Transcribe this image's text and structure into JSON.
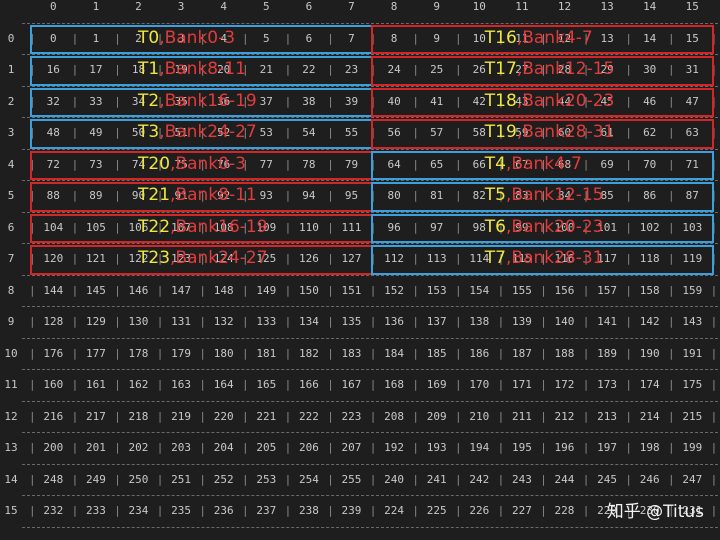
{
  "grid": {
    "columns": [
      "0",
      "1",
      "2",
      "3",
      "4",
      "5",
      "6",
      "7",
      "8",
      "9",
      "10",
      "11",
      "12",
      "13",
      "14",
      "15"
    ],
    "rows": [
      {
        "label": "0",
        "cells": [
          "0",
          "1",
          "2",
          "3",
          "4",
          "5",
          "6",
          "7",
          "8",
          "9",
          "10",
          "11",
          "12",
          "13",
          "14",
          "15"
        ]
      },
      {
        "label": "1",
        "cells": [
          "16",
          "17",
          "18",
          "19",
          "20",
          "21",
          "22",
          "23",
          "24",
          "25",
          "26",
          "27",
          "28",
          "29",
          "30",
          "31"
        ]
      },
      {
        "label": "2",
        "cells": [
          "32",
          "33",
          "34",
          "35",
          "36",
          "37",
          "38",
          "39",
          "40",
          "41",
          "42",
          "43",
          "44",
          "45",
          "46",
          "47"
        ]
      },
      {
        "label": "3",
        "cells": [
          "48",
          "49",
          "50",
          "51",
          "52",
          "53",
          "54",
          "55",
          "56",
          "57",
          "58",
          "59",
          "60",
          "61",
          "62",
          "63"
        ]
      },
      {
        "label": "4",
        "cells": [
          "72",
          "73",
          "74",
          "75",
          "76",
          "77",
          "78",
          "79",
          "64",
          "65",
          "66",
          "67",
          "68",
          "69",
          "70",
          "71"
        ]
      },
      {
        "label": "5",
        "cells": [
          "88",
          "89",
          "90",
          "91",
          "92",
          "93",
          "94",
          "95",
          "80",
          "81",
          "82",
          "83",
          "84",
          "85",
          "86",
          "87"
        ]
      },
      {
        "label": "6",
        "cells": [
          "104",
          "105",
          "106",
          "107",
          "108",
          "109",
          "110",
          "111",
          "96",
          "97",
          "98",
          "99",
          "100",
          "101",
          "102",
          "103"
        ]
      },
      {
        "label": "7",
        "cells": [
          "120",
          "121",
          "122",
          "123",
          "124",
          "125",
          "126",
          "127",
          "112",
          "113",
          "114",
          "115",
          "116",
          "117",
          "118",
          "119"
        ]
      },
      {
        "label": "8",
        "cells": [
          "144",
          "145",
          "146",
          "147",
          "148",
          "149",
          "150",
          "151",
          "152",
          "153",
          "154",
          "155",
          "156",
          "157",
          "158",
          "159"
        ]
      },
      {
        "label": "9",
        "cells": [
          "128",
          "129",
          "130",
          "131",
          "132",
          "133",
          "134",
          "135",
          "136",
          "137",
          "138",
          "139",
          "140",
          "141",
          "142",
          "143"
        ]
      },
      {
        "label": "10",
        "cells": [
          "176",
          "177",
          "178",
          "179",
          "180",
          "181",
          "182",
          "183",
          "184",
          "185",
          "186",
          "187",
          "188",
          "189",
          "190",
          "191"
        ]
      },
      {
        "label": "11",
        "cells": [
          "160",
          "161",
          "162",
          "163",
          "164",
          "165",
          "166",
          "167",
          "168",
          "169",
          "170",
          "171",
          "172",
          "173",
          "174",
          "175"
        ]
      },
      {
        "label": "12",
        "cells": [
          "216",
          "217",
          "218",
          "219",
          "220",
          "221",
          "222",
          "223",
          "208",
          "209",
          "210",
          "211",
          "212",
          "213",
          "214",
          "215"
        ]
      },
      {
        "label": "13",
        "cells": [
          "200",
          "201",
          "202",
          "203",
          "204",
          "205",
          "206",
          "207",
          "192",
          "193",
          "194",
          "195",
          "196",
          "197",
          "198",
          "199"
        ]
      },
      {
        "label": "14",
        "cells": [
          "248",
          "249",
          "250",
          "251",
          "252",
          "253",
          "254",
          "255",
          "240",
          "241",
          "242",
          "243",
          "244",
          "245",
          "246",
          "247"
        ]
      },
      {
        "label": "15",
        "cells": [
          "232",
          "233",
          "234",
          "235",
          "236",
          "237",
          "238",
          "239",
          "224",
          "225",
          "226",
          "227",
          "228",
          "229",
          "230",
          "231"
        ]
      }
    ]
  },
  "groups": [
    {
      "row": 0,
      "half": "left",
      "color": "#3aa0e0",
      "thread": "T0",
      "bank": ",Bank0-3"
    },
    {
      "row": 1,
      "half": "left",
      "color": "#3aa0e0",
      "thread": "T1",
      "bank": ",Bank8-11"
    },
    {
      "row": 2,
      "half": "left",
      "color": "#3aa0e0",
      "thread": "T2",
      "bank": ",Bank16-19"
    },
    {
      "row": 3,
      "half": "left",
      "color": "#3aa0e0",
      "thread": "T3",
      "bank": ",Bank24-27"
    },
    {
      "row": 0,
      "half": "right",
      "color": "#d42626",
      "thread": "T16",
      "bank": ",Bank4-7"
    },
    {
      "row": 1,
      "half": "right",
      "color": "#d42626",
      "thread": "T17",
      "bank": ",Bank12-15"
    },
    {
      "row": 2,
      "half": "right",
      "color": "#d42626",
      "thread": "T18",
      "bank": ",Bank20-23"
    },
    {
      "row": 3,
      "half": "right",
      "color": "#d42626",
      "thread": "T19",
      "bank": ",Bank28-31"
    },
    {
      "row": 4,
      "half": "left",
      "color": "#d42626",
      "thread": "T20",
      "bank": ",Bank0-3"
    },
    {
      "row": 5,
      "half": "left",
      "color": "#d42626",
      "thread": "T21",
      "bank": ",Bank8-11"
    },
    {
      "row": 6,
      "half": "left",
      "color": "#d42626",
      "thread": "T22",
      "bank": ",Bank16-19"
    },
    {
      "row": 7,
      "half": "left",
      "color": "#d42626",
      "thread": "T23",
      "bank": ",Bank24-27"
    },
    {
      "row": 4,
      "half": "right",
      "color": "#3aa0e0",
      "thread": "T4",
      "bank": ",Bank4-7"
    },
    {
      "row": 5,
      "half": "right",
      "color": "#3aa0e0",
      "thread": "T5",
      "bank": ",Bank12-15"
    },
    {
      "row": 6,
      "half": "right",
      "color": "#3aa0e0",
      "thread": "T6",
      "bank": ",Bank20-23"
    },
    {
      "row": 7,
      "half": "right",
      "color": "#3aa0e0",
      "thread": "T7",
      "bank": ",Bank28-31"
    }
  ],
  "watermark": "知乎 @Titus"
}
